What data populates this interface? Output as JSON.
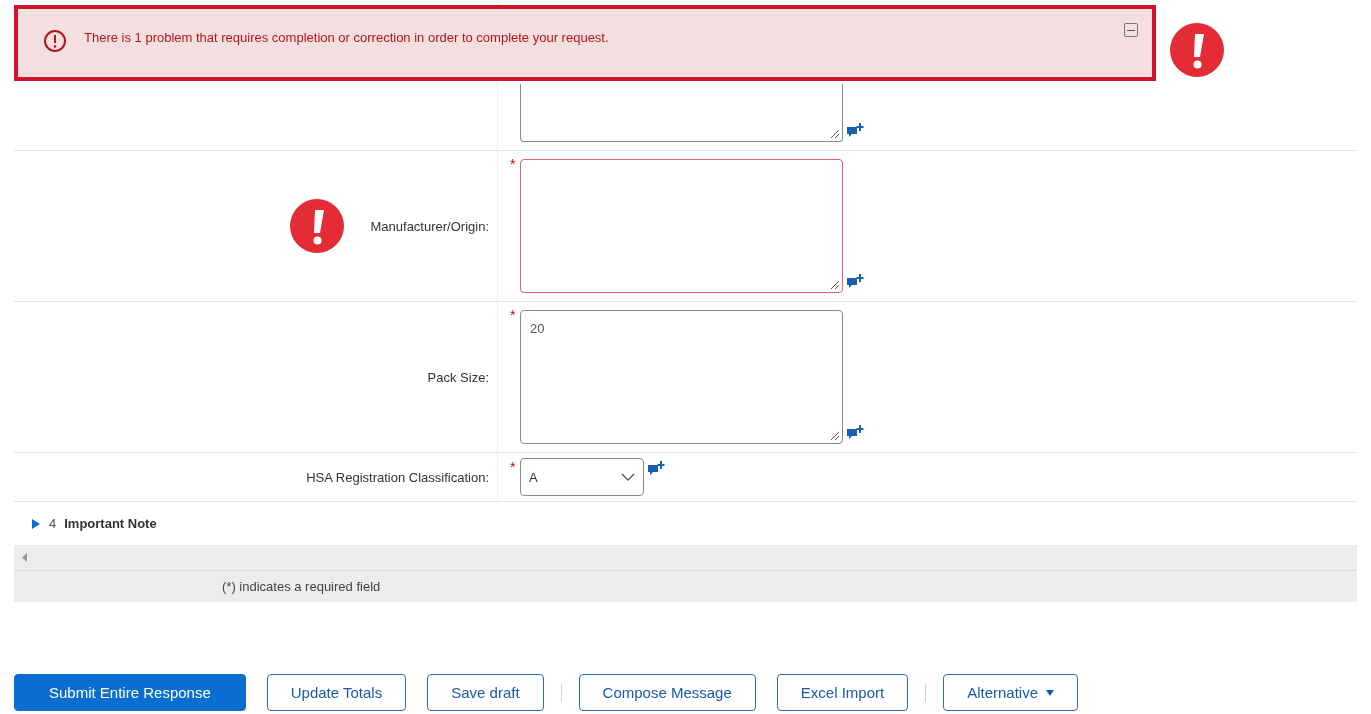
{
  "error_banner": {
    "message": "There is 1 problem that requires completion or correction in order to complete your request.",
    "collapsed": false
  },
  "fields": [
    {
      "kind": "textarea",
      "invalid": false
    },
    {
      "label": "Manufacturer/Origin:",
      "kind": "textarea",
      "required_mark": "*",
      "invalid": true
    },
    {
      "label": "Pack Size:",
      "kind": "textarea",
      "required_mark": "*",
      "invalid": false,
      "value": "20"
    },
    {
      "label": "HSA Registration Classification:",
      "kind": "select",
      "required_mark": "*",
      "invalid": false,
      "value": "A"
    }
  ],
  "section": {
    "number": "4",
    "title": "Important Note",
    "expanded": false
  },
  "required_note": "(*) indicates a required field",
  "button_groups": [
    [
      {
        "label": "Submit Entire Response",
        "primary": true
      },
      {
        "label": "Update Totals",
        "primary": false
      },
      {
        "label": "Save draft",
        "primary": false
      }
    ],
    [
      {
        "label": "Compose Message",
        "primary": false
      },
      {
        "label": "Excel Import",
        "primary": false
      }
    ],
    [
      {
        "label": "Alternative",
        "primary": false,
        "menu": true
      }
    ]
  ]
}
